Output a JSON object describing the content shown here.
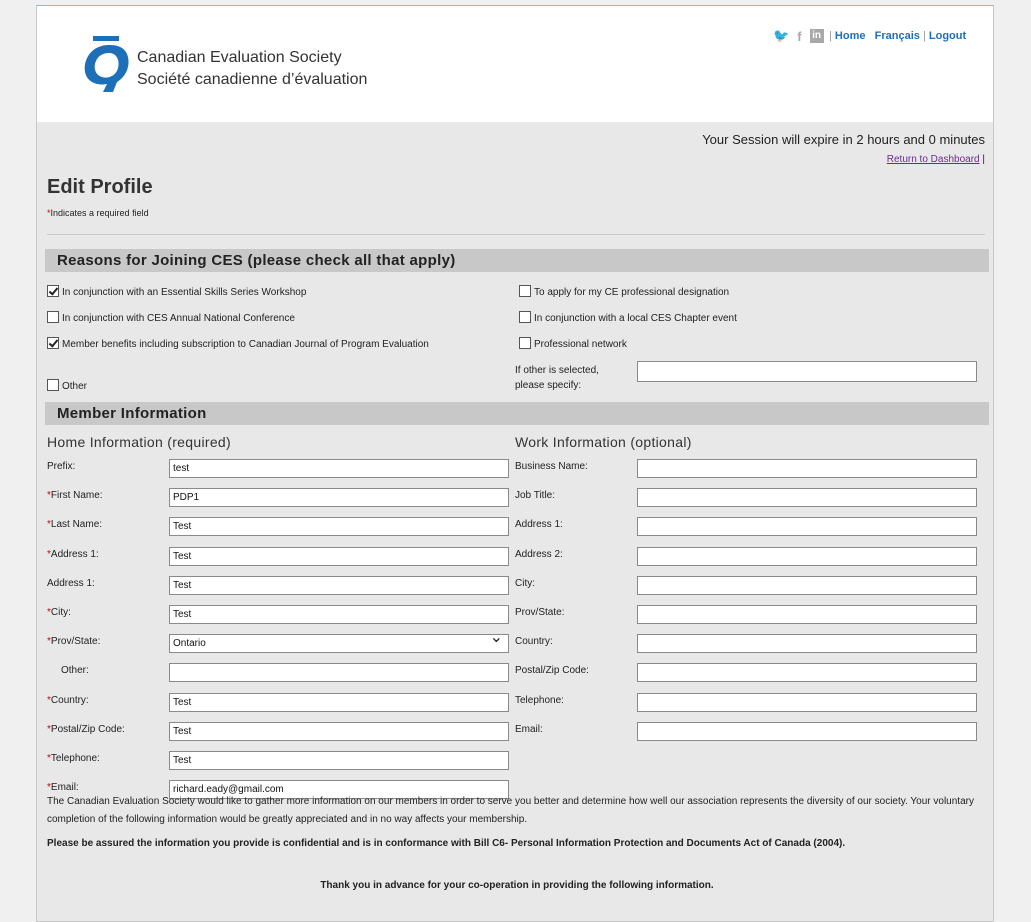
{
  "header": {
    "logo_line_en": "Canadian Evaluation Society",
    "logo_line_fr": "Société canadienne d’évaluation",
    "social_icons": [
      "twitter-icon",
      "facebook-icon",
      "linkedin-icon"
    ],
    "links": {
      "home": "Home",
      "francais": "Français",
      "logout": "Logout"
    },
    "separator": "|"
  },
  "session": {
    "text": "Your Session will expire in 2 hours and 0 minutes",
    "dashboard_link": "Return to Dashboard"
  },
  "page": {
    "title": "Edit Profile",
    "required_marker": "*",
    "required_note": "Indicates a required field"
  },
  "reasons": {
    "heading": "Reasons for Joining CES (please check all that apply)",
    "left": [
      {
        "label": "In conjunction with an Essential Skills Series Workshop",
        "checked": true
      },
      {
        "label": "In conjunction with CES Annual National Conference",
        "checked": false
      },
      {
        "label": "Member benefits including subscription to Canadian Journal of Program Evaluation",
        "checked": true
      },
      {
        "label": "Other",
        "checked": false
      }
    ],
    "right": [
      {
        "label": "To apply for my CE professional designation",
        "checked": false
      },
      {
        "label": "In conjunction with a local CES Chapter event",
        "checked": false
      },
      {
        "label": "Professional network",
        "checked": false
      }
    ],
    "other_label_1": "If other is selected,",
    "other_label_2": "please specify:",
    "other_value": ""
  },
  "member": {
    "heading": "Member Information",
    "home_heading": "Home Information (required)",
    "work_heading": "Work Information (optional)",
    "home_fields": [
      {
        "label": "Prefix:",
        "required": false,
        "value": "test"
      },
      {
        "label": "First Name:",
        "required": true,
        "value": "PDP1"
      },
      {
        "label": "Last Name:",
        "required": true,
        "value": "Test"
      },
      {
        "label": "Address 1:",
        "required": true,
        "value": "Test"
      },
      {
        "label": "Address 1:",
        "required": false,
        "value": "Test"
      },
      {
        "label": "City:",
        "required": true,
        "value": "Test"
      },
      {
        "label": "Prov/State:",
        "required": true,
        "value": "Ontario"
      },
      {
        "label": "Other:",
        "required": false,
        "value": ""
      },
      {
        "label": "Country:",
        "required": true,
        "value": "Test"
      },
      {
        "label": "Postal/Zip Code:",
        "required": true,
        "value": "Test"
      },
      {
        "label": "Telephone:",
        "required": true,
        "value": "Test"
      },
      {
        "label": "Email:",
        "required": true,
        "value": "richard.eady@gmail.com"
      }
    ],
    "work_fields": [
      {
        "label": "Business Name:",
        "value": ""
      },
      {
        "label": "Job Title:",
        "value": ""
      },
      {
        "label": "Address 1:",
        "value": ""
      },
      {
        "label": "Address 2:",
        "value": ""
      },
      {
        "label": "City:",
        "value": ""
      },
      {
        "label": "Prov/State:",
        "value": ""
      },
      {
        "label": "Country:",
        "value": ""
      },
      {
        "label": "Postal/Zip Code:",
        "value": ""
      },
      {
        "label": "Telephone:",
        "value": ""
      },
      {
        "label": "Email:",
        "value": ""
      }
    ]
  },
  "info": {
    "para1": "The Canadian Evaluation Society would like to gather more information on our members in order to serve you better and determine how well our association represents the diversity of our society. Your voluntary completion of the following information would be greatly appreciated and in no way affects your membership.",
    "para2": "Please be assured the information you provide is confidential and is in conformance with Bill C6- Personal Information Protection and Documents Act of Canada (2004).",
    "para3": "Thank you in advance for your co-operation in providing the following information."
  },
  "colors": {
    "accent": "#1d6fb8",
    "section_bg": "#c8c8c8",
    "required": "#cc0000",
    "link_visited": "#6b2c8f"
  }
}
